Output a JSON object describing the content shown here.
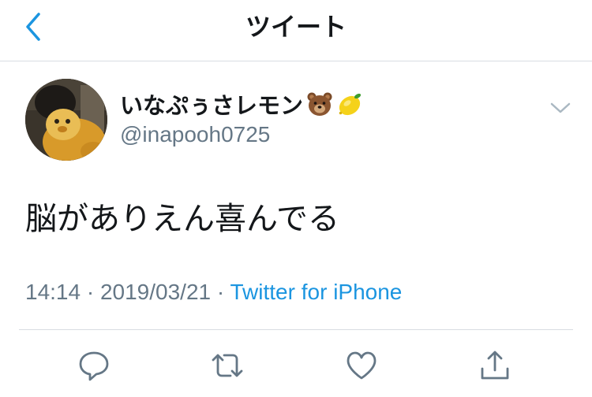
{
  "nav": {
    "title": "ツイート",
    "back_icon": "chevron-left-icon"
  },
  "tweet": {
    "author": {
      "display_name": "いなぷぅさレモン",
      "name_emojis": [
        "bear-face-emoji",
        "lemon-emoji"
      ],
      "username": "@inapooh0725",
      "avatar": "avatar"
    },
    "text": "脳がありえん喜んでる",
    "time": "14:14",
    "separator": "·",
    "date": "2019/03/21",
    "source": "Twitter for iPhone"
  },
  "actions": {
    "icons": [
      "reply-icon",
      "retweet-icon",
      "like-icon",
      "share-icon"
    ]
  },
  "colors": {
    "accent": "#1b95e0",
    "text": "#14171a",
    "secondary": "#657786",
    "divider": "#d8dde2"
  }
}
